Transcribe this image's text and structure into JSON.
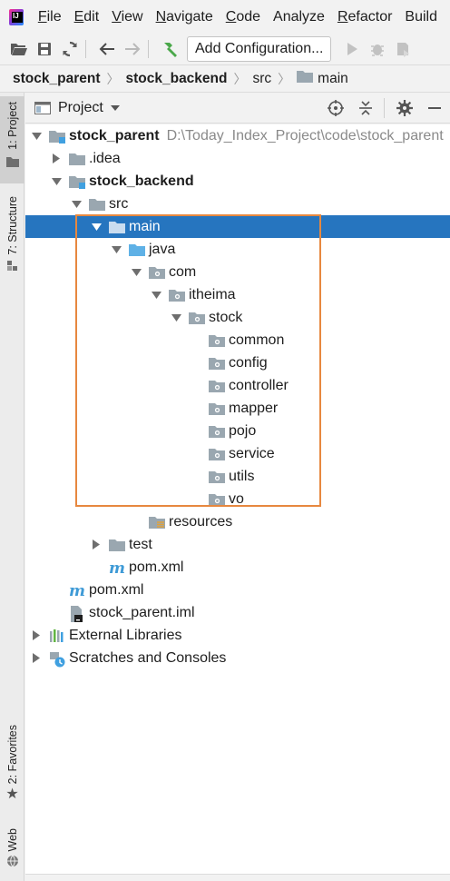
{
  "menu": {
    "app_icon": "intellij-logo",
    "items": [
      {
        "label": "File",
        "mnemonic": "F",
        "rest": "ile"
      },
      {
        "label": "Edit",
        "mnemonic": "E",
        "rest": "dit"
      },
      {
        "label": "View",
        "mnemonic": "V",
        "rest": "iew"
      },
      {
        "label": "Navigate",
        "mnemonic": "N",
        "rest": "avigate"
      },
      {
        "label": "Code",
        "mnemonic": "C",
        "rest": "ode"
      },
      {
        "label": "Analyze",
        "mnemonic": "",
        "rest": "Analyze"
      },
      {
        "label": "Refactor",
        "mnemonic": "R",
        "rest": "efactor"
      },
      {
        "label": "Build",
        "mnemonic": "",
        "rest": "Build"
      }
    ]
  },
  "toolbar": {
    "config_label": "Add Configuration..."
  },
  "breadcrumb": [
    "stock_parent",
    "stock_backend",
    "src",
    "main"
  ],
  "stripe": {
    "project_tab": "1: Project",
    "structure_tab": "7: Structure",
    "favorites_tab": "2: Favorites",
    "web_tab": "Web"
  },
  "panel": {
    "title": "Project"
  },
  "tree": [
    {
      "label": "stock_parent",
      "path": "D:\\Today_Index_Project\\code\\stock_parent",
      "bold": true,
      "icon": "module-folder",
      "arrow": "down"
    },
    {
      "label": ".idea",
      "icon": "folder",
      "arrow": "right"
    },
    {
      "label": "stock_backend",
      "bold": true,
      "icon": "module-folder",
      "arrow": "down"
    },
    {
      "label": "src",
      "icon": "folder",
      "arrow": "down"
    },
    {
      "label": "main",
      "icon": "folder",
      "arrow": "down",
      "selected": true
    },
    {
      "label": "java",
      "icon": "source-folder",
      "arrow": "down"
    },
    {
      "label": "com",
      "icon": "package",
      "arrow": "down"
    },
    {
      "label": "itheima",
      "icon": "package",
      "arrow": "down"
    },
    {
      "label": "stock",
      "icon": "package",
      "arrow": "down"
    },
    {
      "label": "common",
      "icon": "package"
    },
    {
      "label": "config",
      "icon": "package"
    },
    {
      "label": "controller",
      "icon": "package"
    },
    {
      "label": "mapper",
      "icon": "package"
    },
    {
      "label": "pojo",
      "icon": "package"
    },
    {
      "label": "service",
      "icon": "package"
    },
    {
      "label": "utils",
      "icon": "package"
    },
    {
      "label": "vo",
      "icon": "package"
    },
    {
      "label": "resources",
      "icon": "resources-folder"
    },
    {
      "label": "test",
      "icon": "folder",
      "arrow": "right"
    },
    {
      "label": "pom.xml",
      "icon": "maven-file"
    },
    {
      "label": "pom.xml",
      "icon": "maven-file"
    },
    {
      "label": "stock_parent.iml",
      "icon": "iml-file"
    },
    {
      "label": "External Libraries",
      "icon": "libraries",
      "arrow": "right"
    },
    {
      "label": "Scratches and Consoles",
      "icon": "scratches",
      "arrow": "right"
    }
  ]
}
